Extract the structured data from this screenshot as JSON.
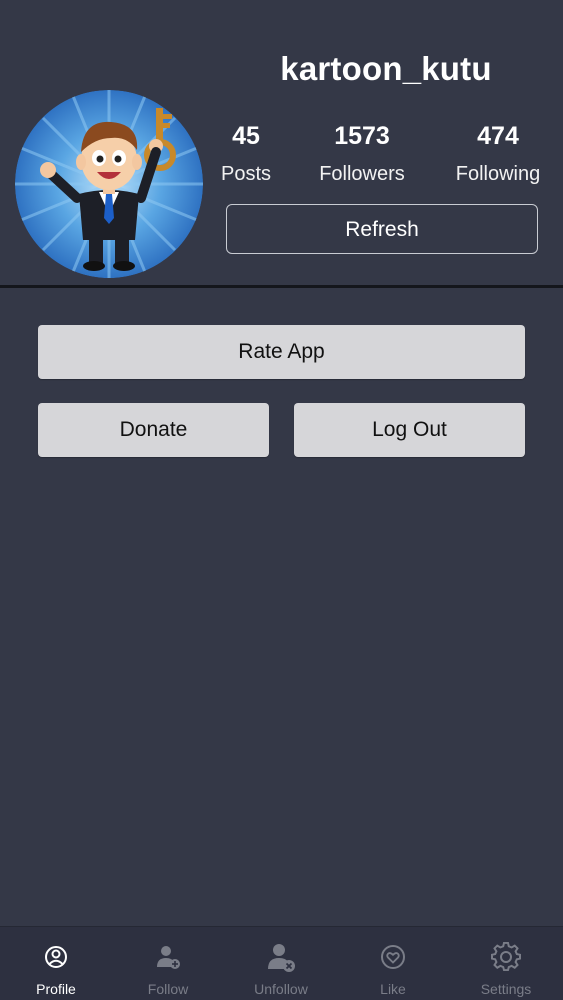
{
  "profile": {
    "username": "kartoon_kutu",
    "stats": {
      "posts": {
        "value": "45",
        "label": "Posts"
      },
      "followers": {
        "value": "1573",
        "label": "Followers"
      },
      "following": {
        "value": "474",
        "label": "Following"
      }
    },
    "refresh_label": "Refresh",
    "avatar_icon": "cartoon-businessman-with-key"
  },
  "actions": {
    "rate_app_label": "Rate App",
    "donate_label": "Donate",
    "logout_label": "Log Out"
  },
  "tabbar": {
    "items": [
      {
        "label": "Profile",
        "icon": "profile-icon",
        "active": true
      },
      {
        "label": "Follow",
        "icon": "follow-user-icon",
        "active": false
      },
      {
        "label": "Unfollow",
        "icon": "unfollow-user-icon",
        "active": false
      },
      {
        "label": "Like",
        "icon": "heart-icon",
        "active": false
      },
      {
        "label": "Settings",
        "icon": "gear-icon",
        "active": false
      }
    ]
  },
  "colors": {
    "background": "#343847",
    "tabbar_background": "#2d3040",
    "button_background": "#d6d6d9",
    "tab_inactive": "#7a7d88",
    "tab_active": "#ffffff"
  }
}
